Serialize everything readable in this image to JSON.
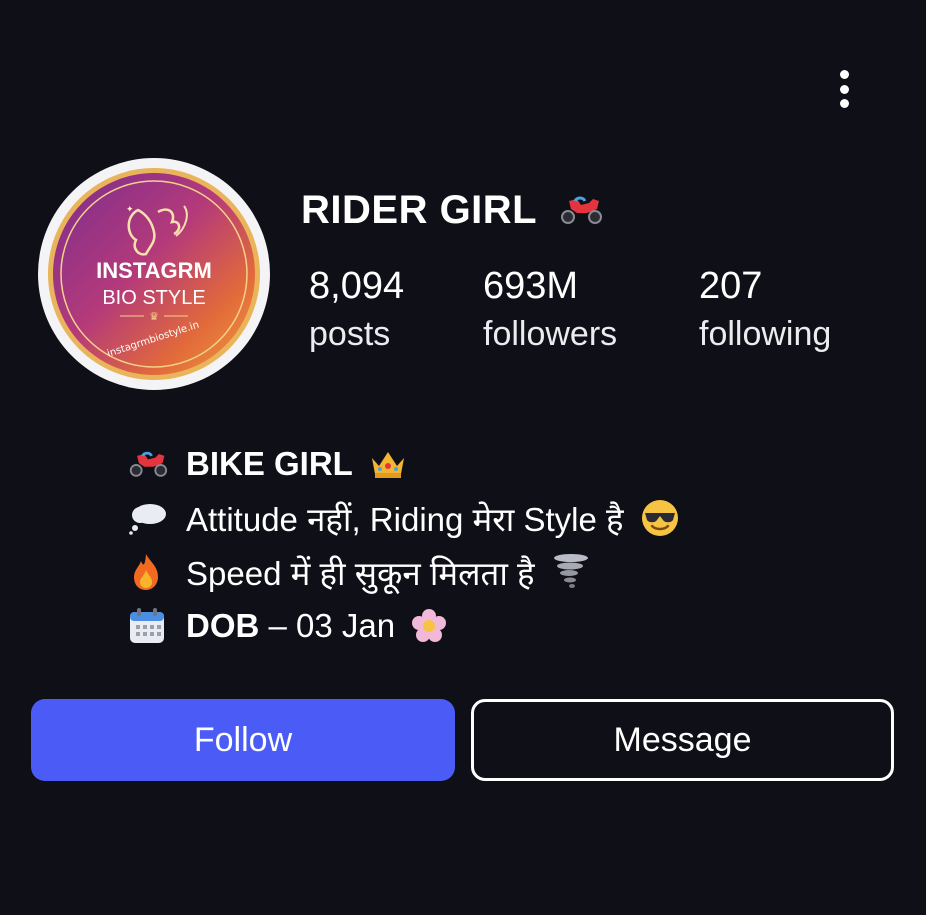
{
  "profile": {
    "name": "RIDER GIRL",
    "name_icon": "motorcycle-icon",
    "avatar": {
      "line1": "INSTAGRM",
      "line2": "BIO STYLE",
      "url": "instagrmbiostyle.in"
    }
  },
  "stats": [
    {
      "value": "8,094",
      "label": "posts"
    },
    {
      "value": "693M",
      "label": "followers"
    },
    {
      "value": "207",
      "label": "following"
    }
  ],
  "bio": {
    "line1": {
      "icon": "motorcycle-icon",
      "text": "BIKE GIRL",
      "end_icon": "crown-icon"
    },
    "line2": {
      "icon": "thought-bubble-icon",
      "text": "Attitude नहीं, Riding मेरा Style है",
      "end_icon": "sunglasses-face-icon"
    },
    "line3": {
      "icon": "fire-icon",
      "text": "Speed में ही सुकून मिलता है",
      "end_icon": "tornado-icon"
    },
    "line4": {
      "icon": "calendar-icon",
      "bold": "DOB",
      "rest": " – 03 Jan",
      "end_icon": "blossom-icon"
    }
  },
  "actions": {
    "follow_label": "Follow",
    "message_label": "Message"
  },
  "colors": {
    "background": "#0f0f17",
    "follow_button": "#4a5cf5",
    "text": "#ffffff"
  }
}
